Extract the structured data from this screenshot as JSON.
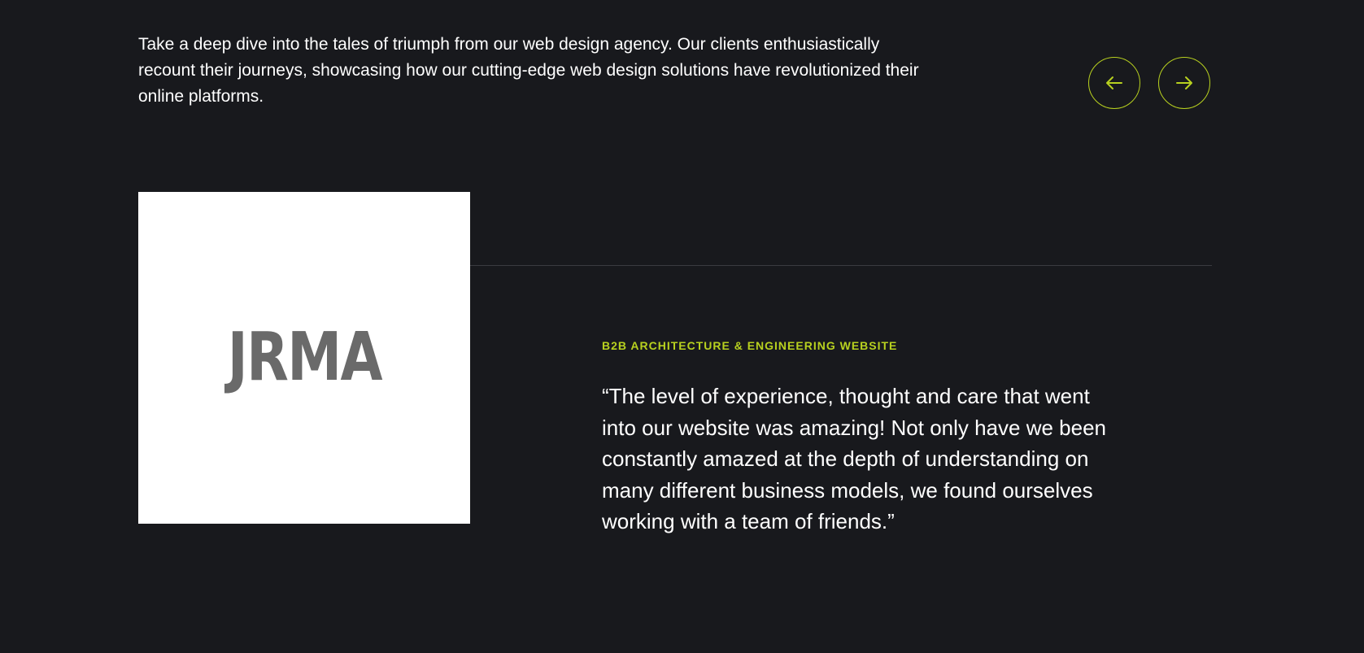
{
  "intro": {
    "text": "Take a deep dive into the tales of triumph from our web design agency. Our clients enthusiastically recount their journeys, showcasing how our cutting-edge web design solutions have revolutionized their online platforms."
  },
  "carousel": {
    "prev_icon": "arrow-left-icon",
    "next_icon": "arrow-right-icon"
  },
  "testimonial": {
    "logo_text": "JRMA",
    "category": "B2B ARCHITECTURE & ENGINEERING WEBSITE",
    "quote": "“The level of experience, thought and care that went into our website was amazing! Not only have we been constantly amazed at the depth of understanding on many different business models, we found ourselves working with a team of friends.”"
  },
  "colors": {
    "background": "#18191d",
    "accent": "#b8d11f",
    "text": "#ffffff",
    "logo_gray": "#6a6a6a",
    "divider": "#3a3b40"
  }
}
